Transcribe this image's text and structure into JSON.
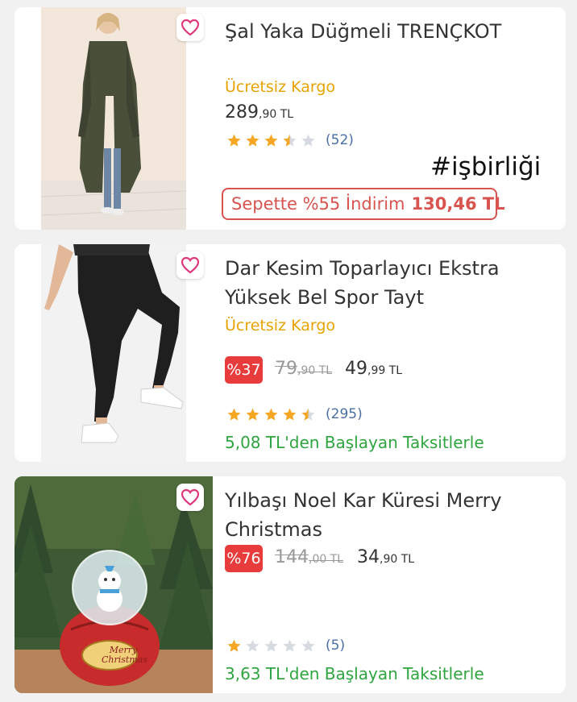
{
  "products": [
    {
      "title": "Şal Yaka Düğmeli TRENÇKOT",
      "shipping": "Ücretsiz Kargo",
      "price_int": "289",
      "price_dec": ",90 TL",
      "rating": 3.5,
      "rating_count": "(52)",
      "overlay_hashtag": "#işbirliği",
      "basket_discount_text": "Sepette %55 İndirim",
      "basket_discount_price": "130,46 TL",
      "image": "trench-coat-photo"
    },
    {
      "title": "Dar Kesim Toparlayıcı Ekstra Yüksek Bel Spor Tayt",
      "shipping": "Ücretsiz Kargo",
      "discount_badge": "%37",
      "old_price_int": "79",
      "old_price_dec": ",90 TL",
      "price_int": "49",
      "price_dec": ",99 TL",
      "rating": 4.5,
      "rating_count": "(295)",
      "installment": "5,08 TL'den Başlayan Taksitlerle",
      "image": "leggings-photo"
    },
    {
      "title": "Yılbaşı Noel Kar Küresi Merry Christmas",
      "discount_badge": "%76",
      "old_price_int": "144",
      "old_price_dec": ",00 TL",
      "price_int": "34",
      "price_dec": ",90 TL",
      "rating": 1,
      "rating_count": "(5)",
      "installment": "3,63 TL'den Başlayan Taksitlerle",
      "image": "snow-globe-photo",
      "image_label": "Merry Christmas"
    }
  ],
  "colors": {
    "accent_pink": "#e0377d",
    "shipping_orange": "#e8a300",
    "installment_green": "#2ea53f",
    "discount_red": "#e83c3c",
    "star_gold": "#f5a623",
    "star_empty": "#d6dbe1"
  }
}
